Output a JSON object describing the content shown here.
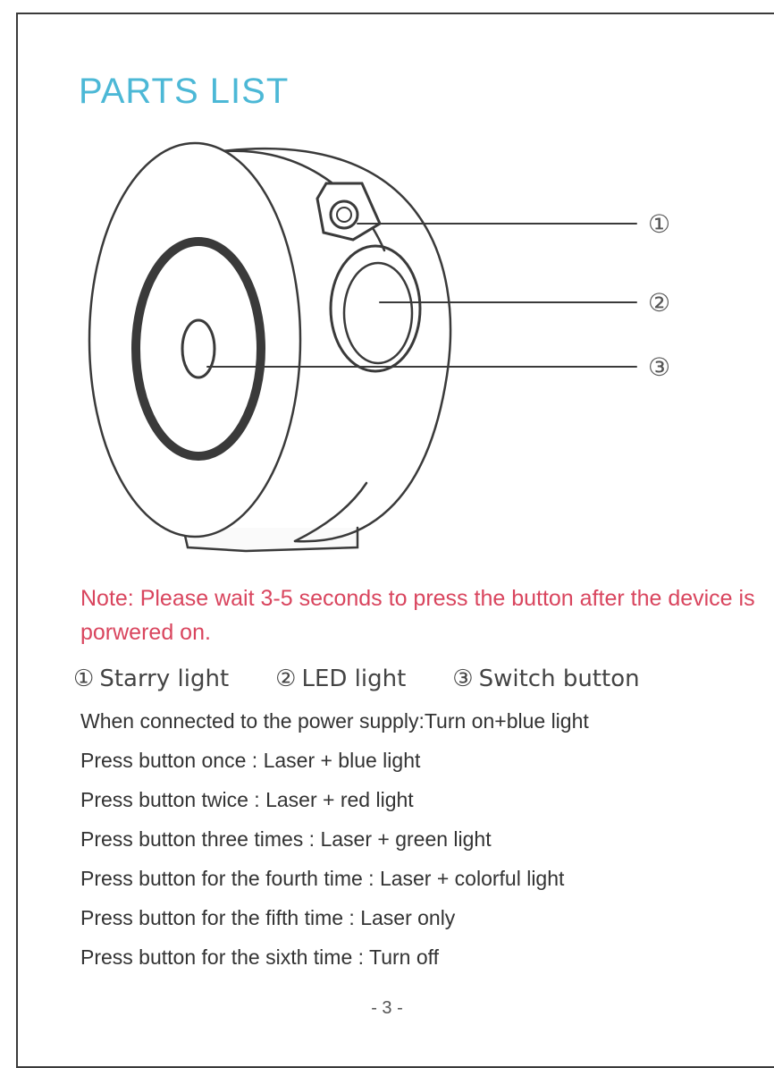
{
  "title": "PARTS LIST",
  "callouts": [
    "①",
    "②",
    "③"
  ],
  "note": "Note: Please wait 3-5 seconds to press the button after the device is porwered on.",
  "legend": [
    {
      "num": "①",
      "label": "Starry light"
    },
    {
      "num": "②",
      "label": "LED light"
    },
    {
      "num": "③",
      "label": "Switch button"
    }
  ],
  "steps": [
    "When connected to the power supply:Turn on+blue light",
    "Press button once : Laser + blue light",
    "Press button twice : Laser + red light",
    "Press button three times : Laser + green light",
    "Press button for the fourth time : Laser + colorful light",
    "Press button for the fifth time : Laser only",
    "Press button for the sixth time : Turn off"
  ],
  "page_number": "- 3 -",
  "colors": {
    "title": "#4cb8d6",
    "note": "#d9455e"
  }
}
